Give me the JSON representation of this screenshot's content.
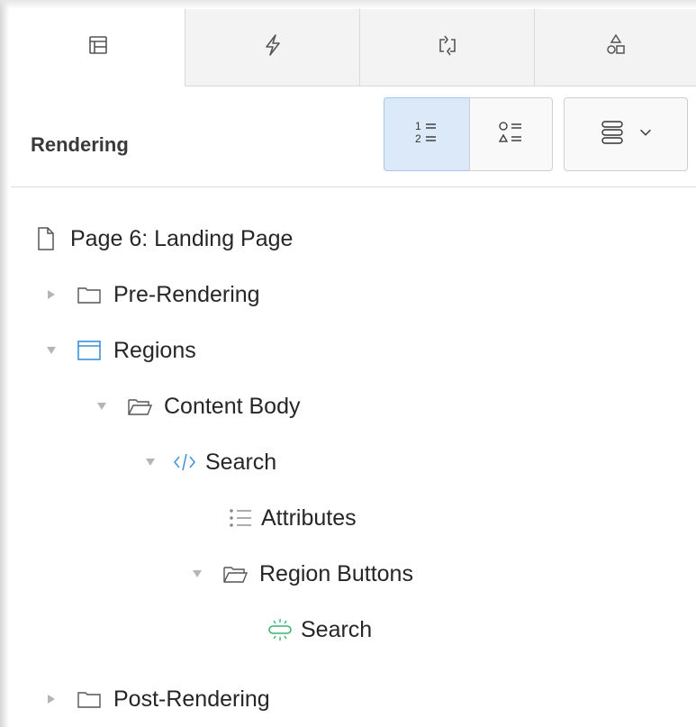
{
  "panel": {
    "title": "Rendering",
    "tabs": [
      {
        "icon": "layout-icon",
        "active": true
      },
      {
        "icon": "lightning-icon",
        "active": false
      },
      {
        "icon": "process-icon",
        "active": false
      },
      {
        "icon": "shapes-icon",
        "active": false
      }
    ],
    "toolbar": {
      "ordered_list_button": "1=\n2=",
      "unordered_list_button": "shapes-list",
      "menu_button": "menu"
    }
  },
  "tree": {
    "items": [
      {
        "label": "Page 6: Landing Page",
        "icon": "page-icon",
        "expanded": null
      },
      {
        "label": "Pre-Rendering",
        "icon": "folder-icon",
        "expanded": false
      },
      {
        "label": "Regions",
        "icon": "region-icon",
        "expanded": true
      },
      {
        "label": "Content Body",
        "icon": "open-folder-icon",
        "expanded": true
      },
      {
        "label": "Search",
        "icon": "code-icon",
        "expanded": true
      },
      {
        "label": "Attributes",
        "icon": "attributes-icon",
        "expanded": null
      },
      {
        "label": "Region Buttons",
        "icon": "open-folder-icon",
        "expanded": true
      },
      {
        "label": "Search",
        "icon": "button-icon",
        "expanded": null
      },
      {
        "label": "Post-Rendering",
        "icon": "folder-icon",
        "expanded": false
      }
    ]
  },
  "colors": {
    "accent": "#3d8fd8",
    "button_green": "#3cb371",
    "segment_active_bg": "#dbe9f8"
  }
}
